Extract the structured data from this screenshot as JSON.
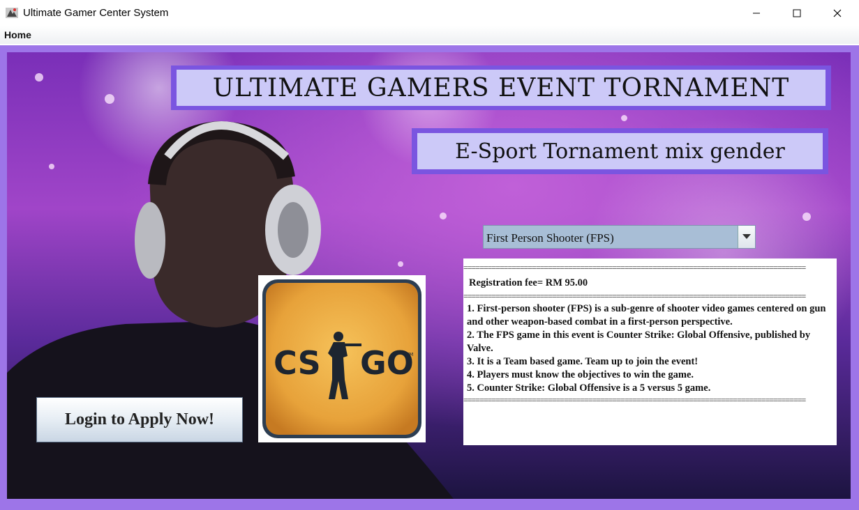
{
  "window": {
    "title": "Ultimate Gamer Center System",
    "icon": "app-icon"
  },
  "window_controls": {
    "minimize": "minimize-icon",
    "maximize": "maximize-icon",
    "close": "close-icon"
  },
  "menu": {
    "items": [
      {
        "label": "Home"
      }
    ]
  },
  "banner": {
    "title": "ULTIMATE GAMERS EVENT TORNAMENT",
    "subtitle": "E-Sport Tornament mix gender"
  },
  "game_select": {
    "selected": "First Person Shooter (FPS)",
    "arrow_icon": "chevron-down-icon"
  },
  "info": {
    "separator": "=====================================================================================",
    "fee": "Registration fee= RM 95.00",
    "lines": [
      "1. First-person shooter (FPS) is a sub-genre of shooter video games centered on gun and other weapon-based combat in a first-person perspective.",
      "2. The FPS game in this event is Counter Strike: Global Offensive, published by Valve.",
      "3. It is a Team based game. Team up to join the event!",
      "4. Players must know the objectives to win the game.",
      "5. Counter Strike: Global Offensive is a 5 versus 5 game."
    ]
  },
  "game_logo": {
    "text_left": "CS",
    "text_right": "GO",
    "tm": "TM"
  },
  "login_button": {
    "label": "Login to Apply Now!"
  },
  "colors": {
    "frame": "#9d75e8",
    "title_bg": "#ccc9f8",
    "title_border": "#7a55e0",
    "combo": "#a8bed6"
  }
}
